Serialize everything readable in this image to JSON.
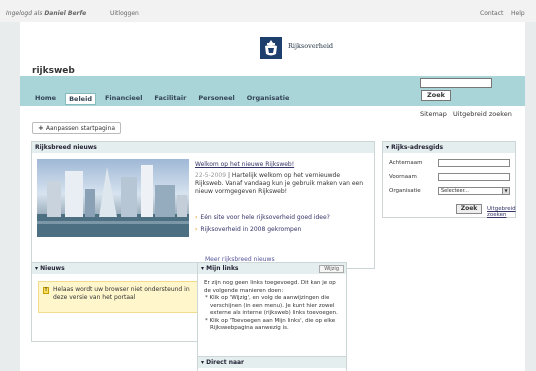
{
  "topbar": {
    "logged_in_prefix": "Ingelogd als",
    "user_name": "Daniel Berfe",
    "logout": "Uitloggen",
    "contact": "Contact",
    "help": "Help"
  },
  "banner": {
    "logo_icon": "royal-crest-icon",
    "logo_text": "Rijksoverheid",
    "site_name": "rijksweb"
  },
  "nav": {
    "items": [
      "Home",
      "Beleid",
      "Financieel",
      "Facilitair",
      "Personeel",
      "Organisatie"
    ],
    "active": "Beleid"
  },
  "search": {
    "input_value": "",
    "button_label": "Zoek",
    "sitemap": "Sitemap",
    "advanced": "Uitgebreid zoeken"
  },
  "add_button": {
    "icon": "+",
    "label": "Aanpassen startpagina"
  },
  "news_panel": {
    "title": "Rijksbreed nieuws",
    "headline": "Welkom op het nieuwe Rijksweb!",
    "date": "22-5-2009",
    "body": "| Hartelijk welkom op het vernieuwde Rijksweb. Vanaf vandaag kun je gebruik maken van een nieuw vormgegeven Rijksweb!",
    "links": [
      "Eén site voor hele rijksoverheid goed idee?",
      "Rijksoverheid in 2008 gekrompen"
    ],
    "more": "Meer rijksbreed nieuws"
  },
  "address_panel": {
    "title": "Rijks-adresgids",
    "fields": [
      {
        "label": "Achternaam",
        "value": ""
      },
      {
        "label": "Voornaam",
        "value": ""
      }
    ],
    "org_label": "Organisatie",
    "org_selected": "Selecteer...",
    "button_label": "Zoek",
    "advanced": "Uitgebreid zoeken"
  },
  "nieuws_panel": {
    "title": "Nieuws",
    "warning": "Helaas wordt uw browser niet ondersteund in deze versie van het portaal"
  },
  "mijn_links_panel": {
    "title": "Mijn links",
    "edit_label": "Wijzig",
    "text": "Er zijn nog geen links toegevoegd. Dit kan je op de volgende manieren doen:",
    "bullets": [
      "Klik op 'Wijzig', en volg de aanwijzingen die verschijnen (in een menu). Je kunt hier zowel externe als interne (rijksweb) links toevoegen.",
      "Klik op 'Toevoegen aan Mijn links', die op elke Rijkswebpagina aanwezig is."
    ]
  },
  "direct_panel": {
    "title": "Direct naar"
  },
  "colors": {
    "navbar": "#a9d5d9",
    "panel_header": "#e4eeee",
    "warning_bg": "#fff6cc",
    "link": "#333366"
  }
}
